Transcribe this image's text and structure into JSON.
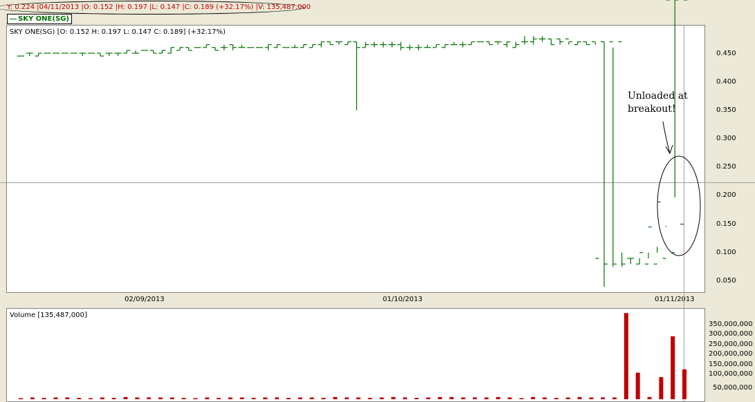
{
  "header": {
    "cursor_readout": "Y: 0.224 |04/11/2013 |O: 0.152 |H: 0.197 |L: 0.147 |C: 0.189 (+32.17%) |V: 135,487,000",
    "legend_label": "SKY ONE(SG)"
  },
  "price_panel": {
    "title": "SKY ONE(SG) [O: 0.152  H: 0.197  L: 0.147  C: 0.189] (+32.17%)",
    "y_ticks": [
      "0.450",
      "0.400",
      "0.350",
      "0.300",
      "0.250",
      "0.200",
      "0.150",
      "0.100",
      "0.050"
    ],
    "date_labels": [
      "02/09/2013",
      "01/10/2013",
      "01/11/2013"
    ]
  },
  "volume_panel": {
    "title": "Volume [135,487,000]",
    "y_ticks": [
      "350,000,000",
      "300,000,000",
      "250,000,000",
      "200,000,000",
      "150,000,000",
      "100,000,000",
      "50,000,000"
    ]
  },
  "annotation": {
    "line1": "Unloaded at",
    "line2": "breakout!"
  },
  "colors": {
    "price": "#007000",
    "volume": "#c00000"
  },
  "chart_data": [
    {
      "type": "ohlc",
      "title": "SKY ONE(SG)",
      "ylim": [
        0.02,
        0.5
      ],
      "x": [
        "2013-08-26",
        "2013-08-27",
        "2013-08-28",
        "2013-08-29",
        "2013-08-30",
        "2013-09-02",
        "2013-09-03",
        "2013-09-04",
        "2013-09-05",
        "2013-09-06",
        "2013-09-09",
        "2013-09-10",
        "2013-09-11",
        "2013-09-12",
        "2013-09-13",
        "2013-09-16",
        "2013-09-17",
        "2013-09-18",
        "2013-09-19",
        "2013-09-20",
        "2013-09-23",
        "2013-09-24",
        "2013-09-25",
        "2013-09-26",
        "2013-09-27",
        "2013-09-30",
        "2013-10-01",
        "2013-10-02",
        "2013-10-03",
        "2013-10-04",
        "2013-10-07",
        "2013-10-08",
        "2013-10-09",
        "2013-10-10",
        "2013-10-11",
        "2013-10-14",
        "2013-10-15",
        "2013-10-16",
        "2013-10-17",
        "2013-10-18",
        "2013-10-21",
        "2013-10-22",
        "2013-10-23",
        "2013-10-24",
        "2013-10-25",
        "2013-10-28",
        "2013-10-29",
        "2013-10-30",
        "2013-10-31",
        "2013-11-01",
        "2013-11-04"
      ],
      "open": [
        0.445,
        0.45,
        0.445,
        0.45,
        0.45,
        0.45,
        0.45,
        0.45,
        0.45,
        0.45,
        0.45,
        0.45,
        0.45,
        0.45,
        0.455,
        0.455,
        0.45,
        0.45,
        0.455,
        0.46,
        0.46,
        0.46,
        0.46,
        0.46,
        0.465,
        0.46,
        0.46,
        0.46,
        0.46,
        0.46,
        0.46,
        0.46,
        0.46,
        0.46,
        0.465,
        0.47,
        0.47,
        0.465,
        0.47,
        0.46,
        0.465,
        0.465,
        0.465,
        0.465,
        0.46,
        0.46,
        0.46,
        0.46,
        0.46,
        0.465,
        0.465,
        0.465,
        0.47,
        0.47,
        0.47,
        0.465,
        0.46,
        0.47,
        0.47,
        0.475,
        0.475,
        0.475,
        0.475,
        0.465,
        0.47,
        0.47,
        0.47,
        0.47,
        0.47,
        0.09,
        0.08,
        0.08,
        0.08,
        0.09,
        0.1,
        0.15
      ],
      "high": [
        0.445,
        0.45,
        0.45,
        0.45,
        0.45,
        0.45,
        0.45,
        0.45,
        0.45,
        0.45,
        0.45,
        0.45,
        0.455,
        0.455,
        0.455,
        0.455,
        0.455,
        0.46,
        0.46,
        0.46,
        0.46,
        0.465,
        0.46,
        0.465,
        0.465,
        0.465,
        0.46,
        0.46,
        0.465,
        0.465,
        0.46,
        0.465,
        0.465,
        0.465,
        0.47,
        0.47,
        0.47,
        0.47,
        0.47,
        0.47,
        0.47,
        0.47,
        0.47,
        0.47,
        0.465,
        0.465,
        0.465,
        0.465,
        0.465,
        0.47,
        0.47,
        0.47,
        0.47,
        0.47,
        0.47,
        0.47,
        0.47,
        0.48,
        0.48,
        0.48,
        0.475,
        0.475,
        0.47,
        0.47,
        0.47,
        0.47,
        0.47,
        0.46,
        0.1,
        0.09,
        0.09,
        0.1,
        0.11,
        0.145,
        0.197
      ],
      "low": [
        0.445,
        0.445,
        0.445,
        0.45,
        0.45,
        0.45,
        0.45,
        0.445,
        0.45,
        0.445,
        0.445,
        0.445,
        0.45,
        0.45,
        0.455,
        0.45,
        0.45,
        0.45,
        0.455,
        0.455,
        0.46,
        0.46,
        0.455,
        0.455,
        0.455,
        0.46,
        0.46,
        0.46,
        0.455,
        0.46,
        0.46,
        0.46,
        0.46,
        0.46,
        0.46,
        0.465,
        0.465,
        0.465,
        0.35,
        0.46,
        0.46,
        0.46,
        0.46,
        0.455,
        0.455,
        0.455,
        0.46,
        0.46,
        0.46,
        0.465,
        0.46,
        0.465,
        0.47,
        0.465,
        0.465,
        0.46,
        0.46,
        0.465,
        0.465,
        0.47,
        0.465,
        0.465,
        0.465,
        0.465,
        0.465,
        0.465,
        0.04,
        0.075,
        0.075,
        0.08,
        0.08,
        0.09,
        0.1,
        0.147
      ],
      "close": [
        0.445,
        0.45,
        0.45,
        0.45,
        0.45,
        0.45,
        0.45,
        0.45,
        0.45,
        0.445,
        0.45,
        0.45,
        0.455,
        0.45,
        0.455,
        0.45,
        0.455,
        0.46,
        0.46,
        0.455,
        0.46,
        0.465,
        0.455,
        0.46,
        0.46,
        0.46,
        0.46,
        0.46,
        0.465,
        0.465,
        0.46,
        0.46,
        0.465,
        0.465,
        0.47,
        0.465,
        0.47,
        0.47,
        0.46,
        0.465,
        0.465,
        0.465,
        0.465,
        0.46,
        0.46,
        0.46,
        0.46,
        0.465,
        0.465,
        0.465,
        0.465,
        0.47,
        0.47,
        0.465,
        0.47,
        0.47,
        0.465,
        0.47,
        0.475,
        0.475,
        0.465,
        0.47,
        0.47,
        0.47,
        0.465,
        0.09,
        0.08,
        0.08,
        0.08,
        0.09,
        0.1,
        0.145,
        0.189
      ]
    },
    {
      "type": "bar",
      "title": "Volume",
      "ylim": [
        0,
        400000000
      ],
      "values": [
        5000000,
        8000000,
        6000000,
        8000000,
        8000000,
        6000000,
        5000000,
        8000000,
        6000000,
        10000000,
        8000000,
        8000000,
        8000000,
        8000000,
        6000000,
        5000000,
        8000000,
        6000000,
        8000000,
        8000000,
        6000000,
        8000000,
        8000000,
        6000000,
        8000000,
        8000000,
        6000000,
        10000000,
        8000000,
        8000000,
        6000000,
        8000000,
        10000000,
        8000000,
        6000000,
        8000000,
        10000000,
        10000000,
        8000000,
        8000000,
        8000000,
        10000000,
        8000000,
        5000000,
        10000000,
        8000000,
        6000000,
        8000000,
        10000000,
        8000000,
        8000000,
        8000000,
        390000000,
        120000000,
        10000000,
        100000000,
        285000000,
        135487000
      ]
    }
  ]
}
